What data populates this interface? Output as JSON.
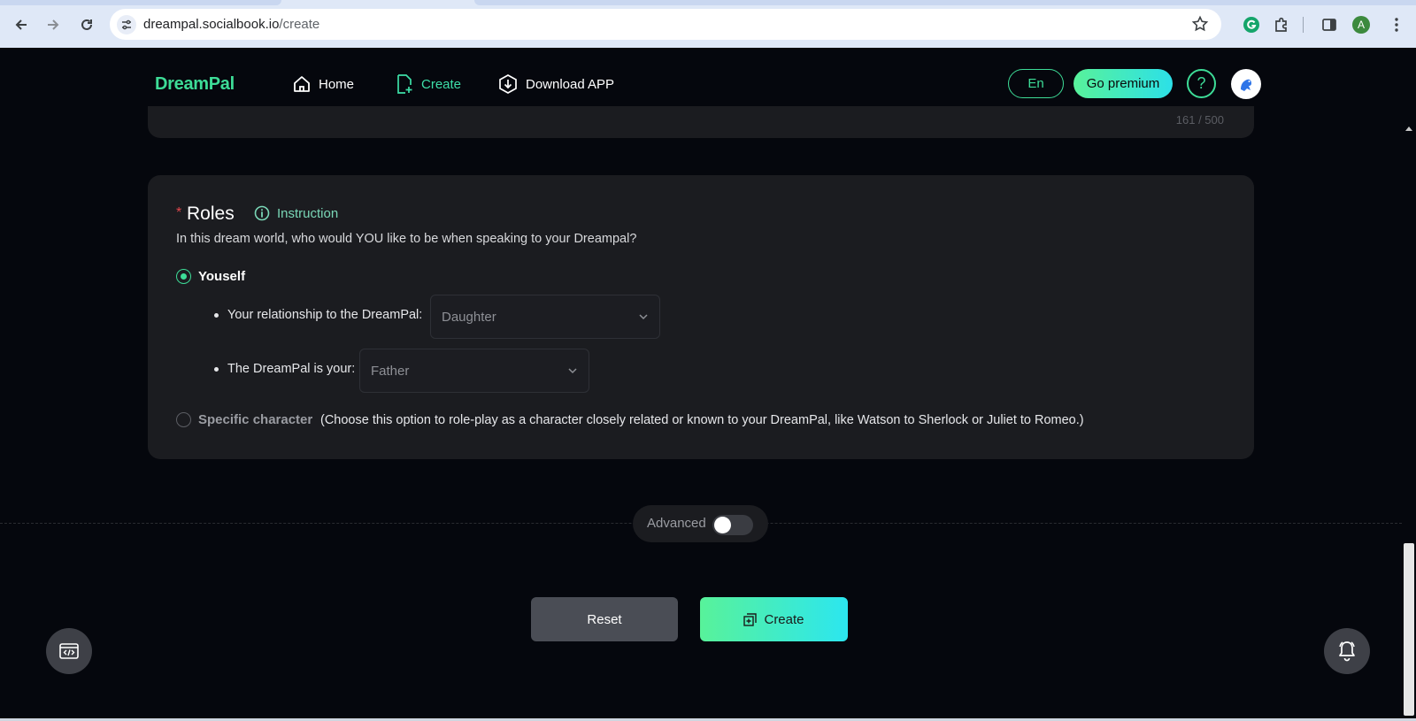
{
  "browser": {
    "url_host": "dreampal.socialbook.io",
    "url_path": "/create",
    "profile_initial": "A"
  },
  "header": {
    "logo": "DreamPal",
    "nav": {
      "home": "Home",
      "create": "Create",
      "download": "Download APP"
    },
    "lang": "En",
    "premium": "Go premium",
    "help": "?"
  },
  "prev_card": {
    "counter": "161 / 500"
  },
  "roles": {
    "required_mark": "*",
    "title": "Roles",
    "instruction": "Instruction",
    "description": "In this dream world, who would YOU like to be when speaking to your Dreampal?",
    "option_yourself": "Youself",
    "relationship_label": "Your relationship to the DreamPal:",
    "relationship_value": "Daughter",
    "dreampal_is_label": "The DreamPal is your:",
    "dreampal_is_value": "Father",
    "option_specific": "Specific character",
    "specific_desc": "(Choose this option to role-play as a character closely related or known to your DreamPal, like Watson to Sherlock or Juliet to Romeo.)"
  },
  "advanced": {
    "label": "Advanced",
    "enabled": false
  },
  "actions": {
    "reset": "Reset",
    "create": "Create"
  },
  "colors": {
    "accent": "#3ddc97",
    "gradient_start": "#58f29a",
    "gradient_end": "#2ce6ef",
    "background": "#05070d",
    "card": "#1b1c20",
    "required": "#e0474c"
  }
}
